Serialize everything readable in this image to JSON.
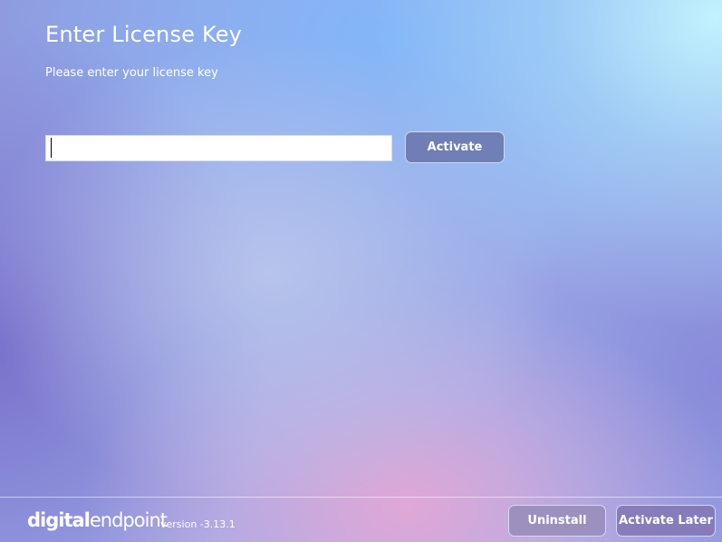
{
  "header": {
    "title": "Enter License Key",
    "subtitle": "Please enter your license key"
  },
  "license": {
    "input_value": "",
    "input_placeholder": "",
    "activate_label": "Activate"
  },
  "footer": {
    "logo_part_bold": "digital",
    "logo_part_light": "endpoint",
    "version": "version -3.13.1",
    "uninstall_label": "Uninstall",
    "activate_later_label": "Activate Later"
  },
  "colors": {
    "button_primary": "#6874aa",
    "logo_dot_colors": [
      "#e53935",
      "#43a047",
      "#1e88e5",
      "#fdd835"
    ]
  }
}
